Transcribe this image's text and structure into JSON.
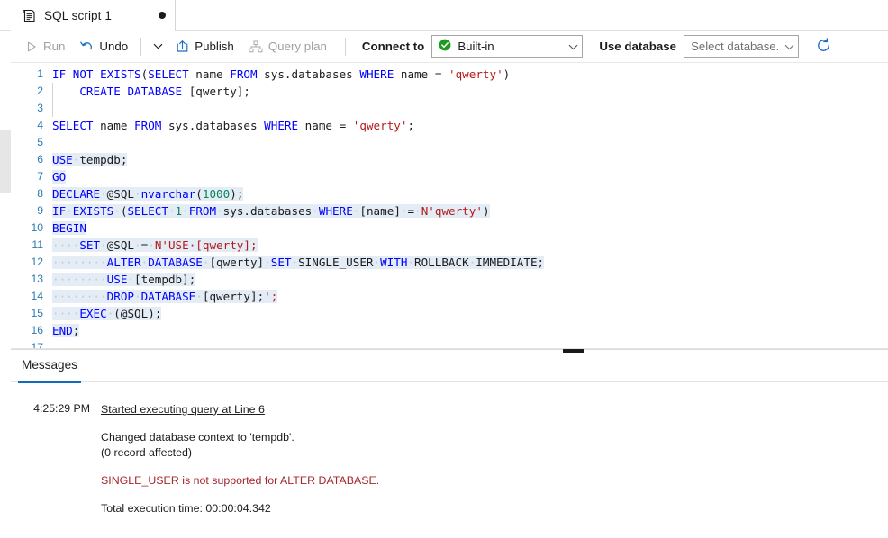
{
  "tab": {
    "icon": "script-file-icon",
    "label": "SQL script 1",
    "dirty_indicator": "unsaved-dot"
  },
  "toolbar": {
    "run_label": "Run",
    "run_enabled": false,
    "undo_label": "Undo",
    "undo_enabled": true,
    "more_caret": "chevron-down",
    "publish_label": "Publish",
    "publish_enabled": true,
    "query_plan_label": "Query plan",
    "query_plan_enabled": false,
    "connect_to_label": "Connect to",
    "connect_to_value": "Built-in",
    "connect_status": "connected",
    "use_database_label": "Use database",
    "database_placeholder": "Select database...",
    "database_value": "",
    "refresh_label": "refresh-icon"
  },
  "editor": {
    "selection_color": "#e4ecf5",
    "keyword_color": "#0000ff",
    "string_color": "#b51a1a",
    "number_color": "#098658",
    "gutter_color": "#2b7ab3",
    "lines": [
      {
        "n": "1",
        "selected": false,
        "text": "IF NOT EXISTS(SELECT name FROM sys.databases WHERE name = 'qwerty')"
      },
      {
        "n": "2",
        "selected": false,
        "text": "    CREATE DATABASE [qwerty];"
      },
      {
        "n": "3",
        "selected": false,
        "text": ""
      },
      {
        "n": "4",
        "selected": false,
        "text": "SELECT name FROM sys.databases WHERE name = 'qwerty';"
      },
      {
        "n": "5",
        "selected": false,
        "text": ""
      },
      {
        "n": "6",
        "selected": true,
        "text": "USE tempdb;"
      },
      {
        "n": "7",
        "selected": true,
        "text": "GO"
      },
      {
        "n": "8",
        "selected": true,
        "text": "DECLARE @SQL nvarchar(1000);"
      },
      {
        "n": "9",
        "selected": true,
        "text": "IF EXISTS (SELECT 1 FROM sys.databases WHERE [name] = N'qwerty')"
      },
      {
        "n": "10",
        "selected": true,
        "text": "BEGIN"
      },
      {
        "n": "11",
        "selected": true,
        "text": "    SET @SQL = N'USE [qwerty];"
      },
      {
        "n": "12",
        "selected": true,
        "text": "        ALTER DATABASE [qwerty] SET SINGLE_USER WITH ROLLBACK IMMEDIATE;"
      },
      {
        "n": "13",
        "selected": true,
        "text": "        USE [tempdb];"
      },
      {
        "n": "14",
        "selected": true,
        "text": "        DROP DATABASE [qwerty];';"
      },
      {
        "n": "15",
        "selected": true,
        "text": "    EXEC (@SQL);"
      },
      {
        "n": "16",
        "selected": true,
        "text": "END;"
      },
      {
        "n": "17",
        "selected": false,
        "text": ""
      }
    ]
  },
  "messages": {
    "tabs": [
      {
        "label": "Messages",
        "active": true
      }
    ],
    "time": "4:25:29 PM",
    "started_link": "Started executing query at Line 6",
    "line1": "Changed database context to 'tempdb'.",
    "line2": "(0 record affected)",
    "error": "SINGLE_USER is not supported for ALTER DATABASE.",
    "total": "Total execution time: 00:00:04.342"
  }
}
